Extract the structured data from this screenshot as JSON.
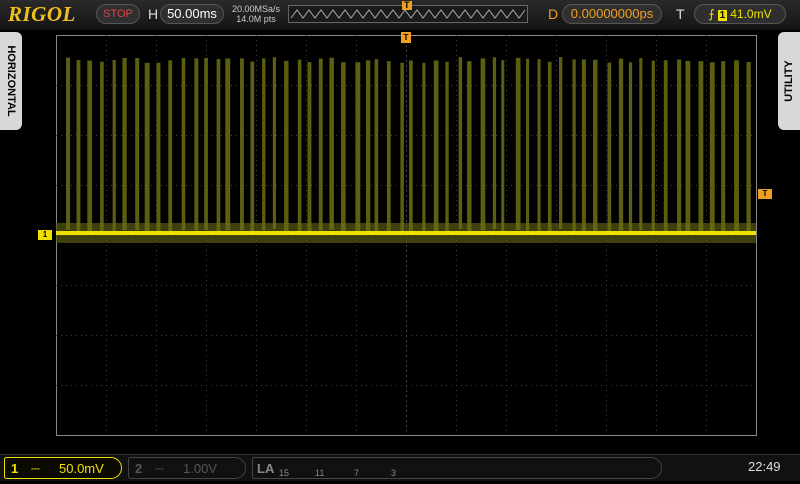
{
  "brand": "RIGOL",
  "top": {
    "run_state": "STOP",
    "h_label": "H",
    "timebase": "50.00ms",
    "sample_rate": "20.00MSa/s",
    "memory_depth": "14.0M pts",
    "d_label": "D",
    "delay": "0.00000000ps",
    "t_label": "T",
    "trigger_source": "1",
    "trigger_level": "41.0mV",
    "trigger_edge_icon": "rising-edge-icon",
    "trigger_marker": "T"
  },
  "tabs": {
    "horizontal": "HORIZONTAL",
    "utility": "UTILITY"
  },
  "markers": {
    "ch1": "1",
    "trig_level": "T"
  },
  "bottom": {
    "ch1": {
      "number": "1",
      "scale": "50.0mV",
      "color": "#f0e000"
    },
    "ch2": {
      "number": "2",
      "scale": "1.00V",
      "color": "#555555"
    },
    "la": {
      "label": "LA",
      "groups": [
        "15",
        "11",
        "7",
        "3"
      ]
    },
    "clock": "22:49"
  },
  "waveform": {
    "color": "#f0e000",
    "pulse_count": 60,
    "description_level": "baseline with periodic spikes"
  }
}
